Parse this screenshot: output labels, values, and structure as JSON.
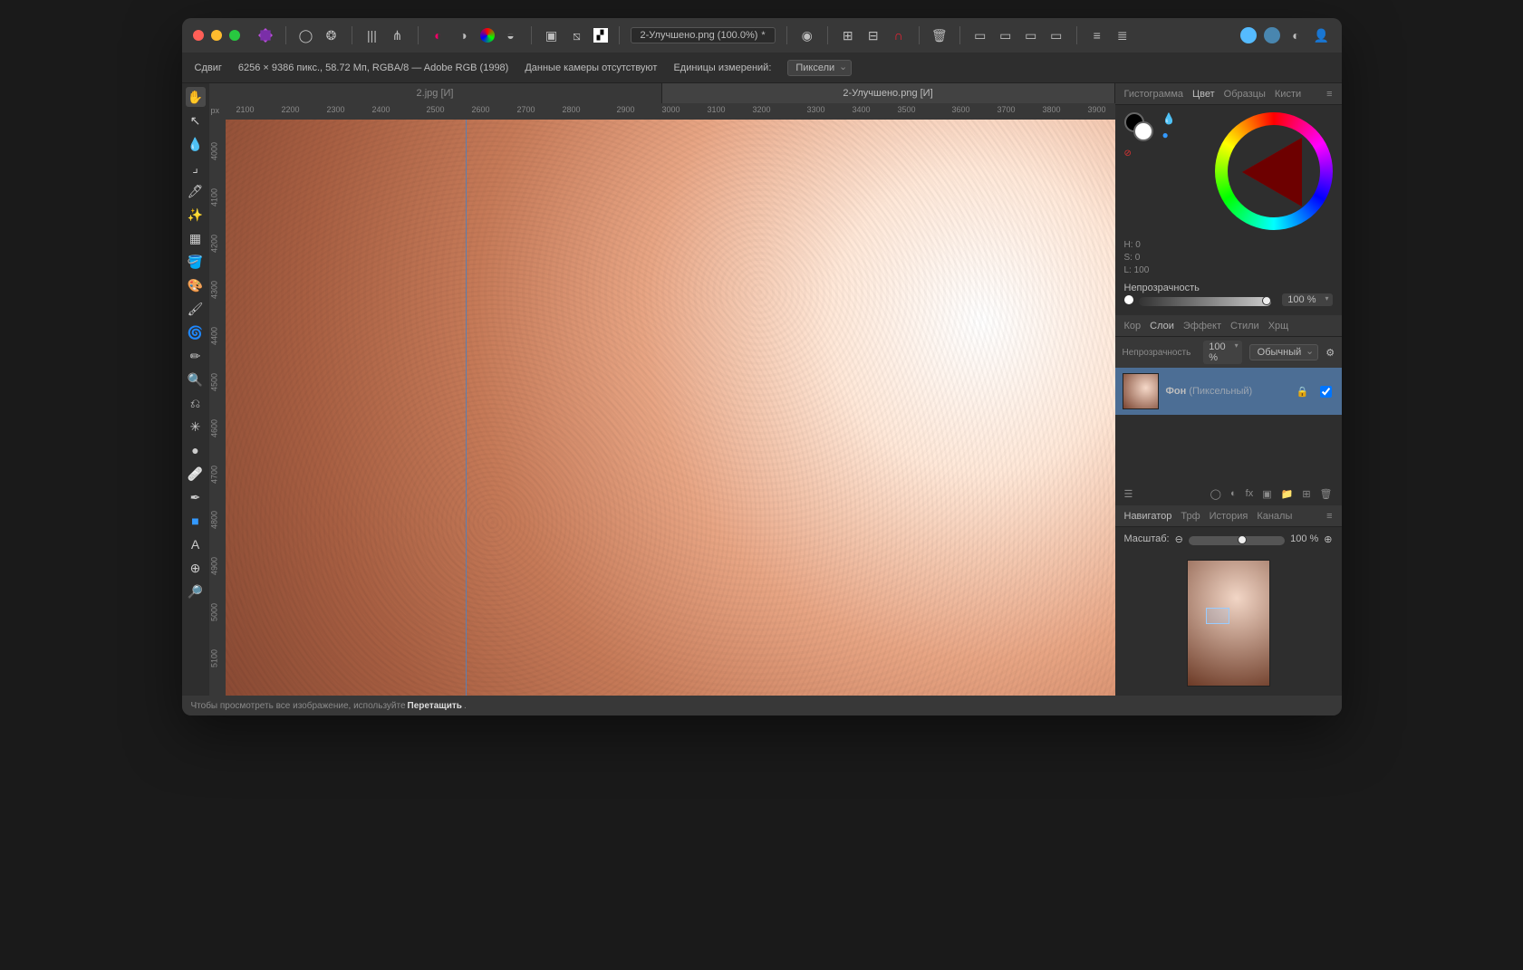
{
  "window": {
    "close": "#ff5f57",
    "min": "#febc2e",
    "max": "#28c840"
  },
  "titlebar": {
    "doc_title": "2-Улучшено.png (100.0%)",
    "modified": "*"
  },
  "context": {
    "tool": "Сдвиг",
    "info": "6256 × 9386 пикс., 58.72 Мп, RGBA/8 — Adobe RGB (1998)",
    "camera": "Данные камеры отсутствуют",
    "units_label": "Единицы измерений:",
    "units_value": "Пиксели"
  },
  "doctabs": [
    {
      "label": "2.jpg [И]",
      "active": false
    },
    {
      "label": "2-Улучшено.png [И]",
      "active": true
    }
  ],
  "ruler": {
    "unit": "px",
    "h": [
      "2100",
      "2200",
      "2300",
      "2400",
      "2500",
      "2600",
      "2700",
      "2800",
      "2900",
      "3000",
      "3100",
      "3200",
      "3300",
      "3400",
      "3500",
      "3600",
      "3700",
      "3800",
      "3900"
    ],
    "v": [
      "4000",
      "4100",
      "4200",
      "4300",
      "4400",
      "4500",
      "4600",
      "4700",
      "4800",
      "4900",
      "5000",
      "5100"
    ]
  },
  "panels": {
    "color_tabs": [
      "Гистограмма",
      "Цвет",
      "Образцы",
      "Кисти"
    ],
    "color_active": "Цвет",
    "hsl": {
      "h": "H: 0",
      "s": "S: 0",
      "l": "L: 100"
    },
    "opacity_label": "Непрозрачность",
    "opacity_value": "100 %",
    "layer_tabs": [
      "Кор",
      "Слои",
      "Эффект",
      "Стили",
      "Хрщ"
    ],
    "layer_active": "Слои",
    "layer_opacity_label": "Непрозрачность",
    "layer_opacity_value": "100 %",
    "blend_mode": "Обычный",
    "layer_name": "Фон",
    "layer_kind": "(Пиксельный)",
    "nav_tabs": [
      "Навигатор",
      "Трф",
      "История",
      "Каналы"
    ],
    "nav_active": "Навигатор",
    "zoom_label": "Масштаб:",
    "zoom_value": "100 %"
  },
  "status": {
    "hint_pre": "Чтобы просмотреть все изображение, используйте ",
    "hint_bold": "Перетащить",
    "hint_post": "."
  }
}
